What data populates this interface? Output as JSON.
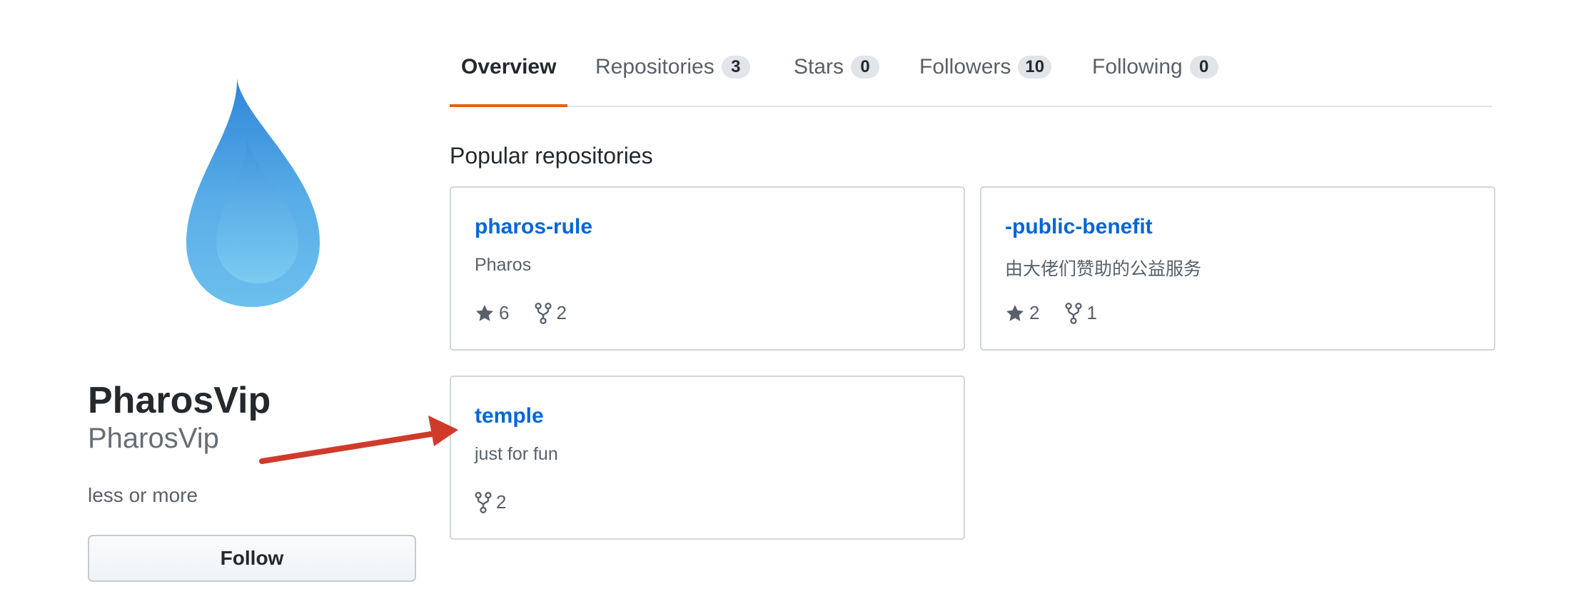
{
  "profile": {
    "name": "PharosVip",
    "login": "PharosVip",
    "bio": "less or more",
    "follow_label": "Follow",
    "avatar_icon": "water-drop-icon"
  },
  "tabs": [
    {
      "label": "Overview",
      "count": null,
      "selected": true
    },
    {
      "label": "Repositories",
      "count": "3",
      "selected": false
    },
    {
      "label": "Stars",
      "count": "0",
      "selected": false
    },
    {
      "label": "Followers",
      "count": "10",
      "selected": false
    },
    {
      "label": "Following",
      "count": "0",
      "selected": false
    }
  ],
  "popular": {
    "title": "Popular repositories",
    "repos": [
      {
        "name": "pharos-rule",
        "description": "Pharos",
        "stars": "6",
        "forks": "2"
      },
      {
        "name": "-public-benefit",
        "description": "由大佬们赞助的公益服务",
        "stars": "2",
        "forks": "1"
      },
      {
        "name": "temple",
        "description": "just for fun",
        "stars": null,
        "forks": "2"
      }
    ]
  },
  "colors": {
    "link": "#0366d6",
    "selected_tab_underline": "#e36209",
    "annotation_arrow": "#d03a2b",
    "avatar_drop": "#5aaee8"
  }
}
